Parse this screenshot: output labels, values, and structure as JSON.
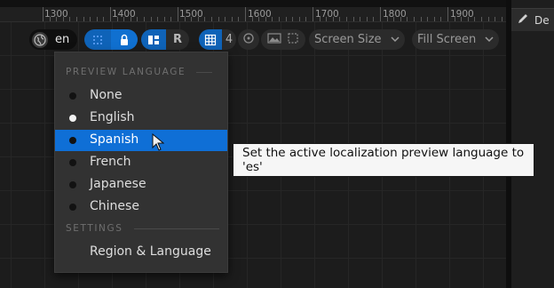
{
  "ruler": {
    "labels": [
      "1300",
      "1400",
      "1500",
      "1600",
      "1700",
      "1800",
      "1900"
    ]
  },
  "side_panel": {
    "tab_label": "De",
    "tab_icon": "pencil-icon"
  },
  "toolbar": {
    "language_icon": "globe-icon",
    "language_code": "en",
    "r_label": "R",
    "grid_count": "4",
    "screen_size_label": "Screen Size",
    "fill_screen_label": "Fill Screen"
  },
  "menu": {
    "section_preview": "PREVIEW LANGUAGE",
    "languages": [
      {
        "label": "None",
        "selected": false,
        "hover": false
      },
      {
        "label": "English",
        "selected": true,
        "hover": false
      },
      {
        "label": "Spanish",
        "selected": false,
        "hover": true
      },
      {
        "label": "French",
        "selected": false,
        "hover": false
      },
      {
        "label": "Japanese",
        "selected": false,
        "hover": false
      },
      {
        "label": "Chinese",
        "selected": false,
        "hover": false
      }
    ],
    "section_settings": "SETTINGS",
    "region_label": "Region & Language"
  },
  "tooltip": {
    "text": "Set the active localization preview language to 'es'"
  },
  "colors": {
    "accent": "#0f6fd6",
    "background": "#1c1c1c",
    "menu": "#323232"
  }
}
